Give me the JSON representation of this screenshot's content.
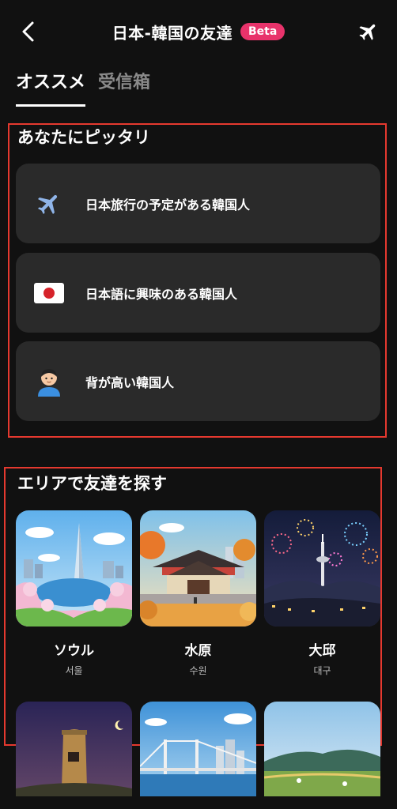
{
  "header": {
    "title": "日本-韓国の友達",
    "badge": "Beta",
    "back_icon": "chevron-left-icon",
    "action_icon": "airplane-icon"
  },
  "tabs": [
    {
      "label": "オススメ",
      "active": true
    },
    {
      "label": "受信箱",
      "active": false
    }
  ],
  "recommend": {
    "title": "あなたにピッタリ",
    "items": [
      {
        "label": "日本旅行の予定がある韓国人",
        "icon": "airplane-icon"
      },
      {
        "label": "日本語に興味のある韓国人",
        "icon": "japan-flag-icon"
      },
      {
        "label": "背が高い韓国人",
        "icon": "person-icon"
      }
    ]
  },
  "areas": {
    "title": "エリアで友達を探す",
    "items": [
      {
        "name": "ソウル",
        "sub": "서울",
        "image": "seoul-illustration"
      },
      {
        "name": "水原",
        "sub": "수원",
        "image": "suwon-illustration"
      },
      {
        "name": "大邱",
        "sub": "대구",
        "image": "daegu-illustration"
      },
      {
        "name": "",
        "sub": "",
        "image": "gyeongju-illustration"
      },
      {
        "name": "",
        "sub": "",
        "image": "busan-illustration"
      },
      {
        "name": "",
        "sub": "",
        "image": "jeju-illustration"
      }
    ]
  },
  "colors": {
    "background": "#111111",
    "card": "#2a2a2a",
    "badge": "#e8336b",
    "highlight": "#e5392f"
  }
}
